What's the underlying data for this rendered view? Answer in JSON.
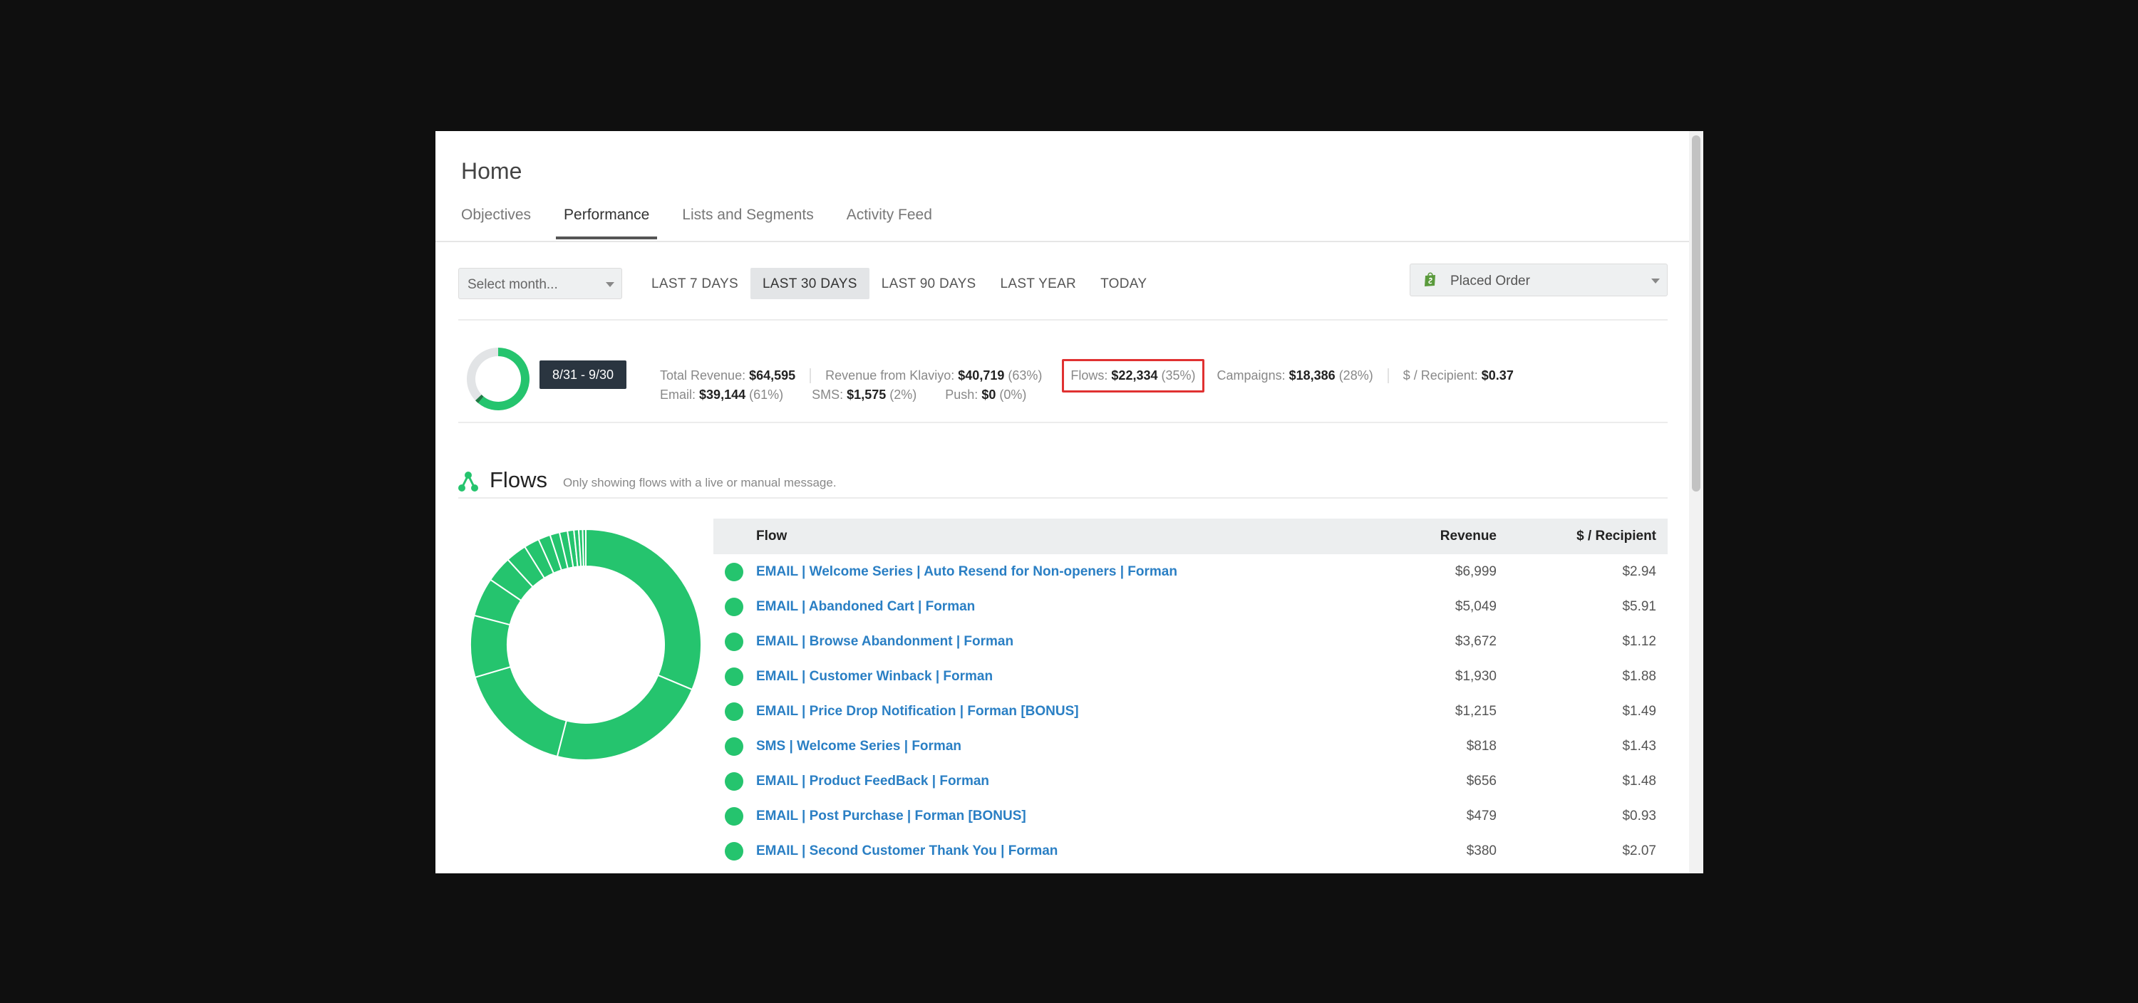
{
  "page": {
    "title": "Home"
  },
  "tabs": [
    {
      "label": "Objectives"
    },
    {
      "label": "Performance",
      "active": true
    },
    {
      "label": "Lists and Segments"
    },
    {
      "label": "Activity Feed"
    }
  ],
  "filters": {
    "month_placeholder": "Select month...",
    "ranges": [
      {
        "label": "LAST 7 DAYS"
      },
      {
        "label": "LAST 30 DAYS",
        "active": true
      },
      {
        "label": "LAST 90 DAYS"
      },
      {
        "label": "LAST YEAR"
      },
      {
        "label": "TODAY"
      }
    ],
    "metric": "Placed Order",
    "metric_icon": "shopify-bag-icon"
  },
  "summary": {
    "date_range": "8/31 - 9/30",
    "total_revenue": {
      "label": "Total Revenue:",
      "value": "$64,595"
    },
    "klaviyo_revenue": {
      "label": "Revenue from Klaviyo:",
      "value": "$40,719",
      "pct": "(63%)"
    },
    "flows": {
      "label": "Flows:",
      "value": "$22,334",
      "pct": "(35%)"
    },
    "campaigns": {
      "label": "Campaigns:",
      "value": "$18,386",
      "pct": "(28%)"
    },
    "per_recipient": {
      "label": "$ / Recipient:",
      "value": "$0.37"
    },
    "email": {
      "label": "Email:",
      "value": "$39,144",
      "pct": "(61%)"
    },
    "sms": {
      "label": "SMS:",
      "value": "$1,575",
      "pct": "(2%)"
    },
    "push": {
      "label": "Push:",
      "value": "$0",
      "pct": "(0%)"
    },
    "mini_chart": {
      "email_share": 61,
      "sms_share": 2
    }
  },
  "flows": {
    "title": "Flows",
    "note": "Only showing flows with a live or manual message.",
    "columns": {
      "flow": "Flow",
      "revenue": "Revenue",
      "per_recipient": "$ / Recipient"
    },
    "rows": [
      {
        "name": "EMAIL | Welcome Series | Auto Resend for Non-openers | Forman",
        "revenue": "$6,999",
        "per_recipient": "$2.94"
      },
      {
        "name": "EMAIL | Abandoned Cart | Forman",
        "revenue": "$5,049",
        "per_recipient": "$5.91"
      },
      {
        "name": "EMAIL | Browse Abandonment | Forman",
        "revenue": "$3,672",
        "per_recipient": "$1.12"
      },
      {
        "name": "EMAIL | Customer Winback | Forman",
        "revenue": "$1,930",
        "per_recipient": "$1.88"
      },
      {
        "name": "EMAIL | Price Drop Notification | Forman [BONUS]",
        "revenue": "$1,215",
        "per_recipient": "$1.49"
      },
      {
        "name": "SMS | Welcome Series | Forman",
        "revenue": "$818",
        "per_recipient": "$1.43"
      },
      {
        "name": "EMAIL | Product FeedBack | Forman",
        "revenue": "$656",
        "per_recipient": "$1.48"
      },
      {
        "name": "EMAIL | Post Purchase | Forman [BONUS]",
        "revenue": "$479",
        "per_recipient": "$0.93"
      },
      {
        "name": "EMAIL | Second Customer Thank You | Forman",
        "revenue": "$380",
        "per_recipient": "$2.07"
      }
    ],
    "donut_values": [
      6999,
      5049,
      3672,
      1930,
      1215,
      818,
      656,
      479,
      380,
      300,
      250,
      200,
      150,
      120,
      100
    ],
    "accent": "#25c46e"
  },
  "colors": {
    "accent": "#25c46e",
    "dark_green": "#1f7a45",
    "link": "#2a7fc4",
    "highlight": "#e03131"
  }
}
